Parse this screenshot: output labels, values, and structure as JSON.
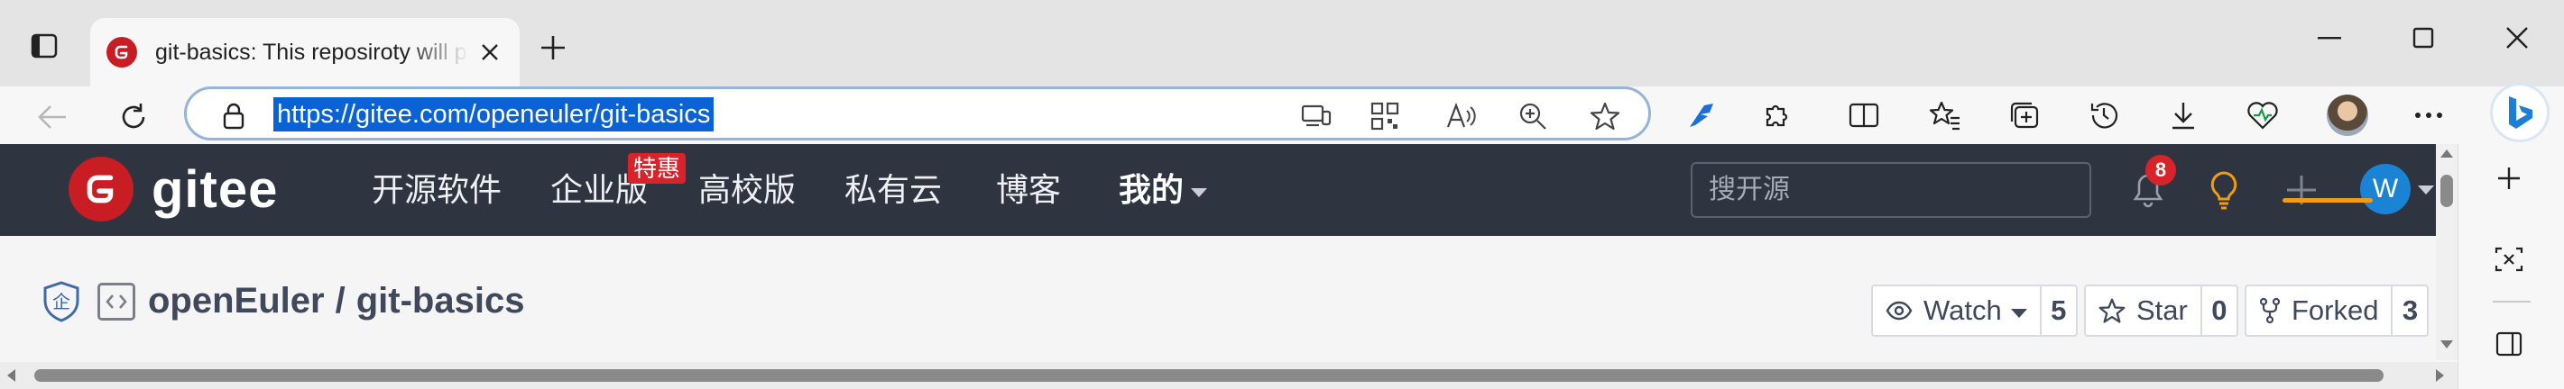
{
  "browser": {
    "tab": {
      "title": "git-basics: This reposiroty will provide git basics",
      "favicon": "gitee-favicon"
    },
    "address": {
      "url": "https://gitee.com/openeuler/git-basics"
    },
    "colors": {
      "url_highlight": "#0a62d4",
      "address_border": "#94b4d8"
    }
  },
  "gitee": {
    "brand": "gitee",
    "nav": {
      "items": [
        "开源软件",
        "企业版",
        "高校版",
        "私有云",
        "博客"
      ],
      "badge": "特惠",
      "mine": "我的"
    },
    "search_placeholder": "搜开源",
    "notifications_count": "8",
    "user_initial": "W",
    "colors": {
      "nav_bg": "#2e3440",
      "brand_red": "#c71d23",
      "avatar_blue": "#1a83d4",
      "fork_accent": "#f39c12"
    }
  },
  "repo": {
    "owner": "openEuler",
    "separator": "/",
    "name": "git-basics",
    "badge_char": "企",
    "watch": {
      "label": "Watch",
      "count": "5"
    },
    "star": {
      "label": "Star",
      "count": "0"
    },
    "fork": {
      "label": "Forked",
      "count": "3"
    }
  }
}
